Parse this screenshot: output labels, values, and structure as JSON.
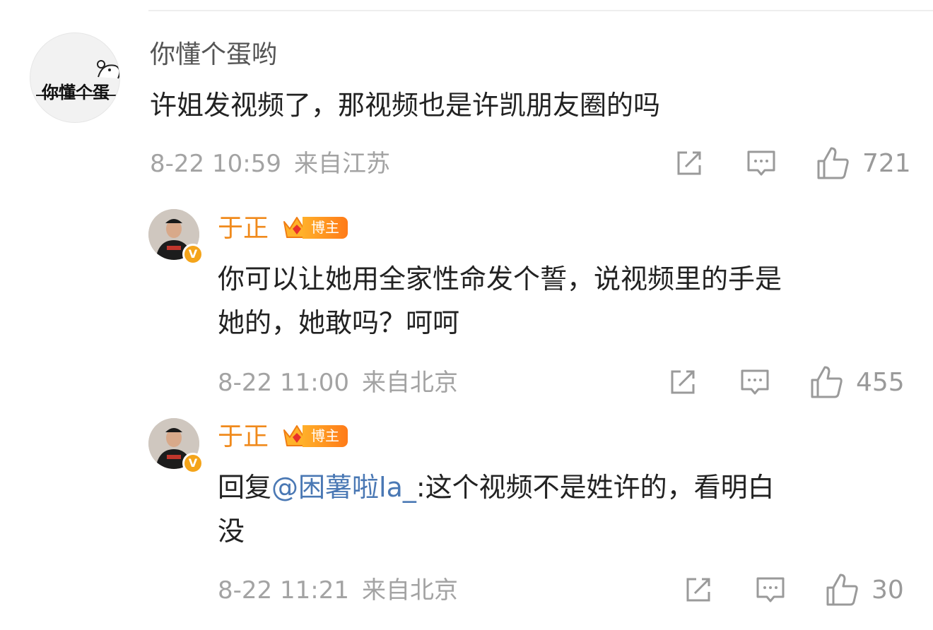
{
  "comments": [
    {
      "avatar_text": "你懂个蛋",
      "username": "你懂个蛋哟",
      "content": "许姐发视频了，那视频也是许凯朋友圈的吗",
      "date": "8-22 10:59",
      "location": "来自江苏",
      "likes": "721"
    },
    {
      "username": "于正",
      "badge": "博主",
      "content_line1": "你可以让她用全家性命发个誓，说视频里的手是",
      "content_line2": "她的，她敢吗？呵呵",
      "date": "8-22 11:00",
      "location": "来自北京",
      "likes": "455"
    },
    {
      "username": "于正",
      "badge": "博主",
      "reply_prefix": "回复",
      "mention": "@困薯啦la_",
      "content_line1": ":这个视频不是姓许的，看明白",
      "content_line2": "没",
      "date": "8-22 11:21",
      "location": "来自北京",
      "likes": "30"
    }
  ],
  "icons": {
    "share": "share-icon",
    "comment": "comment-icon",
    "like": "thumbs-up-icon"
  },
  "colors": {
    "username_vip": "#f08a1c",
    "mention": "#4a78b4",
    "meta": "#a3a3a3"
  }
}
